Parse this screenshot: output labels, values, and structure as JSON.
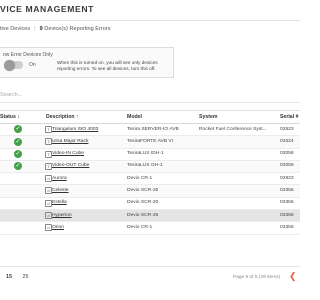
{
  "header": {
    "title": "VICE MANAGEMENT"
  },
  "tabs": {
    "all_label": "tive Devices",
    "count": "9",
    "errors_label": "Device(s) Reporting Errors"
  },
  "filter": {
    "title": "ow Error Devices Only",
    "toggle_label": "On",
    "info": "When this is turned on, you will see only devices reporting errors. To see all devices, turn this off."
  },
  "search": {
    "placeholder": "Search..."
  },
  "table": {
    "columns": {
      "status": "Status",
      "description": "Description",
      "model": "Model",
      "system": "System",
      "serial": "Serial"
    },
    "rows": [
      {
        "status": "ok",
        "icon": "T",
        "description": "Triangulum SIO 4003",
        "model": "Tesira SERVER-IO AVB",
        "system": "Rocket Fuel Conference Syst...",
        "serial": "02623"
      },
      {
        "status": "ok",
        "icon": "T",
        "description": "Ursa Major Rack",
        "model": "TesiraFORTE AVB VI",
        "system": "",
        "serial": "02624"
      },
      {
        "status": "ok",
        "icon": "T",
        "description": "Video-IN Cube",
        "model": "TesiraLUX IDH-1",
        "system": "",
        "serial": "03058"
      },
      {
        "status": "ok",
        "icon": "T",
        "description": "Video-OUT Cube",
        "model": "TesiraLUX OH-1",
        "system": "",
        "serial": "03059"
      },
      {
        "status": "none",
        "icon": "d",
        "description": "Aurora",
        "model": "Devio CR-1",
        "system": "",
        "serial": "02923"
      },
      {
        "status": "none",
        "icon": "d",
        "description": "Celeste",
        "model": "Devio SCR-25",
        "system": "",
        "serial": "03356"
      },
      {
        "status": "none",
        "icon": "d",
        "description": "Estella",
        "model": "Devio SCR-20",
        "system": "",
        "serial": "03356"
      },
      {
        "status": "none",
        "icon": "d",
        "description": "Hyperion",
        "model": "Devio SCR-25",
        "system": "",
        "serial": "03356"
      },
      {
        "status": "none",
        "icon": "d",
        "description": "Orion",
        "model": "Devio CR-1",
        "system": "",
        "serial": "03356"
      }
    ]
  },
  "pager": {
    "sizes": [
      "15",
      "25"
    ],
    "info": "Page 5 of 5 (49 items)",
    "prev_icon": "chevron-left-icon"
  },
  "colors": {
    "ok": "#43a047",
    "accent": "#e85d3a"
  }
}
